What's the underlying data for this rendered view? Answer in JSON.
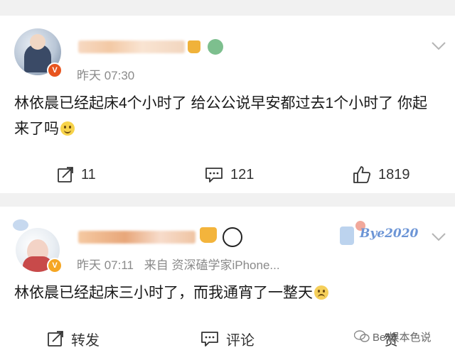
{
  "posts": [
    {
      "username": "",
      "time": "昨天 07:30",
      "source": "",
      "content_text": "林依晨已经起床4个小时了 给公公说早安都过去1个小时了 你起来了吗",
      "reactions": {
        "repost_count": "11",
        "comment_count": "121",
        "like_count": "1819"
      }
    },
    {
      "username": "",
      "time": "昨天 07:11",
      "source": "来自 资深磕学家iPhone...",
      "badge_text": "Bye2020",
      "content_text": "林依晨已经起床三小时了，而我通宵了一整天",
      "reactions": {
        "repost_label": "转发",
        "comment_label": "评论",
        "like_label": "赞"
      }
    }
  ],
  "watermark": "Be 娱本色说",
  "colors": {
    "page_bg": "#f1f1f1",
    "card_bg": "#ffffff",
    "meta_gray": "#8a8a8a",
    "vip_orange": "#f5a623"
  },
  "icons": [
    "avatar",
    "verified-badge-icon",
    "chevron-down-icon",
    "repost-icon",
    "comment-icon",
    "like-icon",
    "smile-emoji-icon",
    "crown-icon",
    "panda-icon",
    "wechat-icon"
  ]
}
